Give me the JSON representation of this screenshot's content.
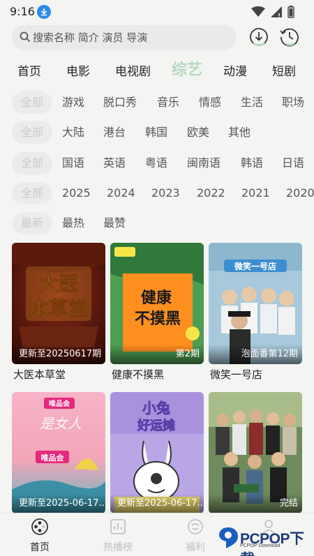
{
  "status_bar": {
    "time": "9:16"
  },
  "search": {
    "placeholder": "搜索名称 简介 演员 导演"
  },
  "nav": {
    "tabs": [
      "首页",
      "电影",
      "电视剧",
      "综艺",
      "动漫",
      "短剧"
    ],
    "active": "综艺"
  },
  "filters": {
    "genre": {
      "all": "全部",
      "options": [
        "游戏",
        "脱口秀",
        "音乐",
        "情感",
        "生活",
        "职场"
      ]
    },
    "region": {
      "all": "全部",
      "options": [
        "大陆",
        "港台",
        "韩国",
        "欧美",
        "其他"
      ]
    },
    "language": {
      "all": "全部",
      "options": [
        "国语",
        "英语",
        "粤语",
        "闽南语",
        "韩语",
        "日语"
      ]
    },
    "year": {
      "all": "全部",
      "options": [
        "2025",
        "2024",
        "2023",
        "2022",
        "2021",
        "2020"
      ]
    },
    "sort": {
      "all": "最新",
      "options": [
        "最热",
        "最赞"
      ]
    }
  },
  "cards": [
    {
      "title": "大医本草堂",
      "status": "更新至20250617期",
      "poster_text": "大医本草堂"
    },
    {
      "title": "健康不摸黑",
      "status": "第2期",
      "poster_text": "健康不摸黑"
    },
    {
      "title": "微笑一号店",
      "status": "泡面番第12期",
      "poster_text": "微笑一号店"
    },
    {
      "title": "",
      "status": "更新至2025-06-17...",
      "poster_text": "唯品会"
    },
    {
      "title": "",
      "status": "更新至2025-06-17...",
      "poster_text": "小兔好运摊"
    },
    {
      "title": "",
      "status": "完结",
      "poster_text": ""
    }
  ],
  "bottom_nav": [
    {
      "label": "首页",
      "active": true
    },
    {
      "label": "热播榜",
      "active": false
    },
    {
      "label": "福利",
      "active": false
    },
    {
      "label": "",
      "active": false
    }
  ],
  "watermark": {
    "text": "PCPOP下载",
    "sub": "PCPOP Download"
  },
  "colors": {
    "accent": "#b8d8c0",
    "background": "#f4f5f3",
    "chip": "#ebecea"
  }
}
